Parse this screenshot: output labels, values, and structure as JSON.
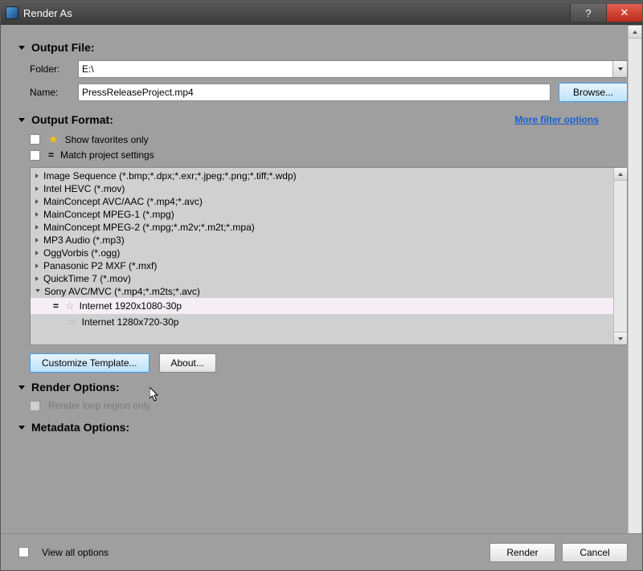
{
  "title": "Render As",
  "sections": {
    "outputFile": "Output File:",
    "outputFormat": "Output Format:",
    "renderOptions": "Render Options:",
    "metadataOptions": "Metadata Options:"
  },
  "outputFile": {
    "folderLabel": "Folder:",
    "folderValue": "E:\\",
    "nameLabel": "Name:",
    "nameValue": "PressReleaseProject.mp4",
    "browse": "Browse..."
  },
  "outputFormat": {
    "showFavorites": "Show favorites only",
    "matchProject": "Match project settings",
    "moreFilter": "More filter options"
  },
  "formats": [
    "Image Sequence (*.bmp;*.dpx;*.exr;*.jpeg;*.png;*.tiff;*.wdp)",
    "Intel HEVC (*.mov)",
    "MainConcept AVC/AAC (*.mp4;*.avc)",
    "MainConcept MPEG-1 (*.mpg)",
    "MainConcept MPEG-2 (*.mpg;*.m2v;*.m2t;*.mpa)",
    "MP3 Audio (*.mp3)",
    "OggVorbis (*.ogg)",
    "Panasonic P2 MXF (*.mxf)",
    "QuickTime 7 (*.mov)",
    "Sony AVC/MVC (*.mp4;*.m2ts;*.avc)"
  ],
  "presets": {
    "p1": "Internet 1920x1080-30p",
    "p2": "Internet 1280x720-30p"
  },
  "buttons": {
    "customize": "Customize Template...",
    "about": "About...",
    "render": "Render",
    "cancel": "Cancel"
  },
  "renderOptions": {
    "loopRegion": "Render loop region only"
  },
  "footer": {
    "viewAll": "View all options"
  }
}
